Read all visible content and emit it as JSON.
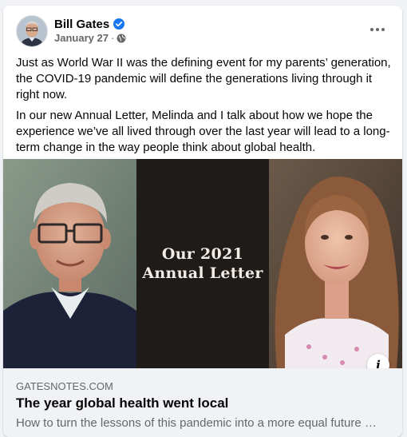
{
  "post": {
    "author": "Bill Gates",
    "date": "January 27",
    "date_separator": " · ",
    "paragraphs": [
      "Just as World War II was the defining event for my parents’ generation, the COVID-19 pandemic will define the generations living through it right now.",
      "In our new Annual Letter, Melinda and I talk about how we hope the experience we’ve all lived through over the last year will lead to a long-term change in the way people think about global health."
    ]
  },
  "media": {
    "overlay_line1": "Our 2021",
    "overlay_line2": "Annual Letter",
    "info_label": "i"
  },
  "link_preview": {
    "domain": "GATESNOTES.COM",
    "title": "The year global health went local",
    "description": "How to turn the lessons of this pandemic into a more equal future …"
  },
  "icons": {
    "verified": "verified-badge-icon",
    "privacy": "globe-icon",
    "more": "more-options-icon",
    "info": "info-icon"
  },
  "colors": {
    "verified_blue": "#1877f2",
    "secondary_text": "#65676b",
    "panel_dark": "#1f1b19"
  }
}
